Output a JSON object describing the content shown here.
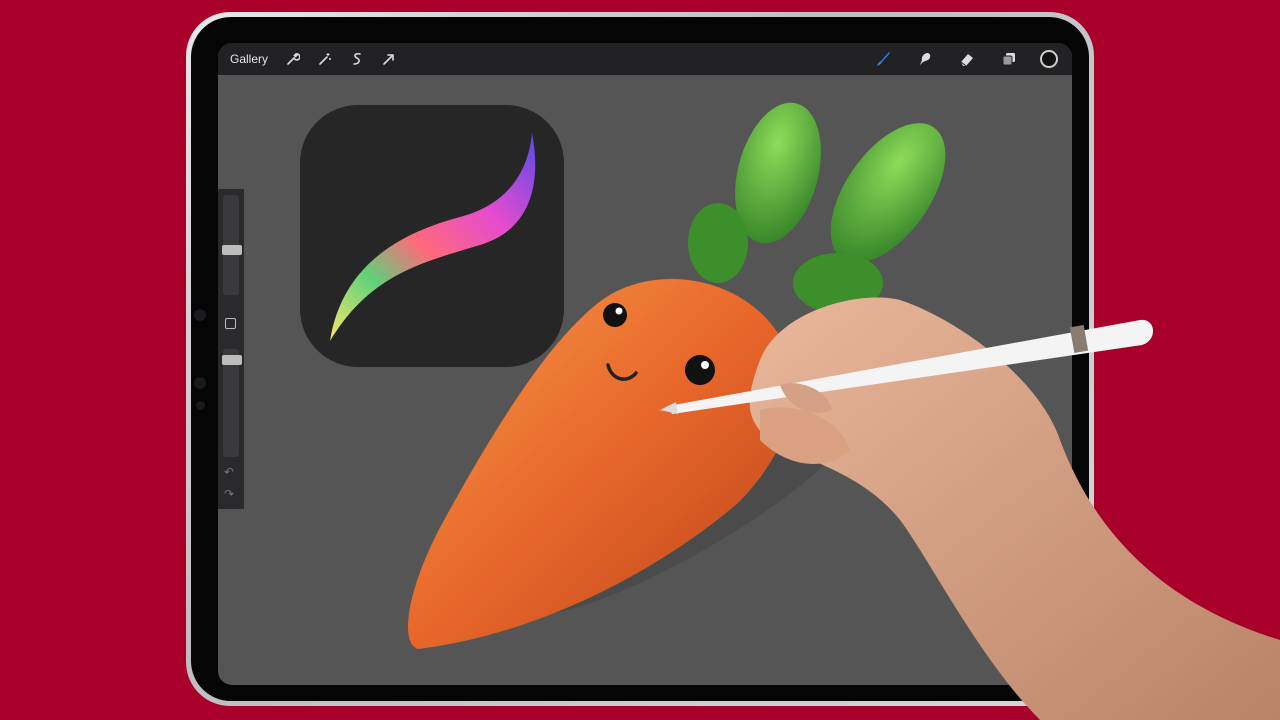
{
  "toolbar": {
    "gallery_label": "Gallery",
    "left_tools": [
      "wrench-icon",
      "magic-wand-icon",
      "selection-icon",
      "transform-arrow-icon"
    ],
    "right_tools": [
      "brush-icon",
      "smudge-icon",
      "eraser-icon",
      "layers-icon"
    ],
    "active_tool": "brush-icon",
    "active_color": "#111111"
  },
  "sidebar": {
    "size_slider_level": 0.55,
    "opacity_slider_level": 0.9,
    "controls": [
      "size-slider",
      "modify-button",
      "opacity-slider",
      "undo-icon",
      "redo-icon"
    ]
  },
  "canvas": {
    "background": "#555555",
    "artwork": [
      "procreate-app-icon",
      "carrot-character"
    ]
  },
  "colors": {
    "backdrop": "#a8002a",
    "carrot": "#e8662a",
    "leaves": "#4caf3a",
    "accent_brush": "#2f7cf6"
  }
}
